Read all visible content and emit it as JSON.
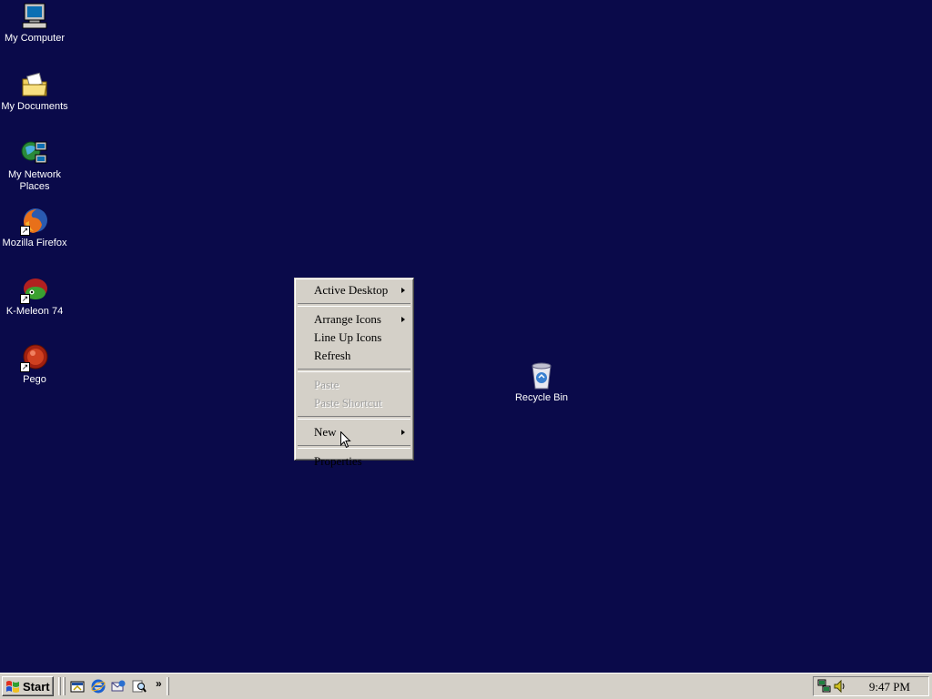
{
  "desktop": {
    "icons": [
      {
        "label": "My Computer",
        "icon": "my-computer-icon"
      },
      {
        "label": "My Documents",
        "icon": "my-documents-icon"
      },
      {
        "label": "My Network Places",
        "icon": "my-network-places-icon"
      },
      {
        "label": "Mozilla Firefox",
        "icon": "firefox-icon"
      },
      {
        "label": "K-Meleon 74",
        "icon": "k-meleon-icon"
      },
      {
        "label": "Pego",
        "icon": "pego-icon"
      },
      {
        "label": "Recycle Bin",
        "icon": "recycle-bin-icon"
      }
    ],
    "background_color": "#0a0a4a"
  },
  "context_menu": {
    "items": [
      {
        "label": "Active Desktop",
        "submenu": true,
        "enabled": true
      },
      {
        "label": "Arrange Icons",
        "submenu": true,
        "enabled": true
      },
      {
        "label": "Line Up Icons",
        "submenu": false,
        "enabled": true
      },
      {
        "label": "Refresh",
        "submenu": false,
        "enabled": true
      },
      {
        "label": "Paste",
        "submenu": false,
        "enabled": false
      },
      {
        "label": "Paste Shortcut",
        "submenu": false,
        "enabled": false
      },
      {
        "label": "New",
        "submenu": true,
        "enabled": true
      },
      {
        "label": "Properties",
        "submenu": false,
        "enabled": true
      }
    ]
  },
  "taskbar": {
    "start_label": "Start",
    "quick_launch": [
      "show-desktop-icon",
      "internet-explorer-icon",
      "outlook-express-icon",
      "search-icon"
    ],
    "more_label": "»",
    "tray_icons": [
      "network-icon",
      "volume-icon"
    ],
    "clock": "9:47 PM"
  }
}
